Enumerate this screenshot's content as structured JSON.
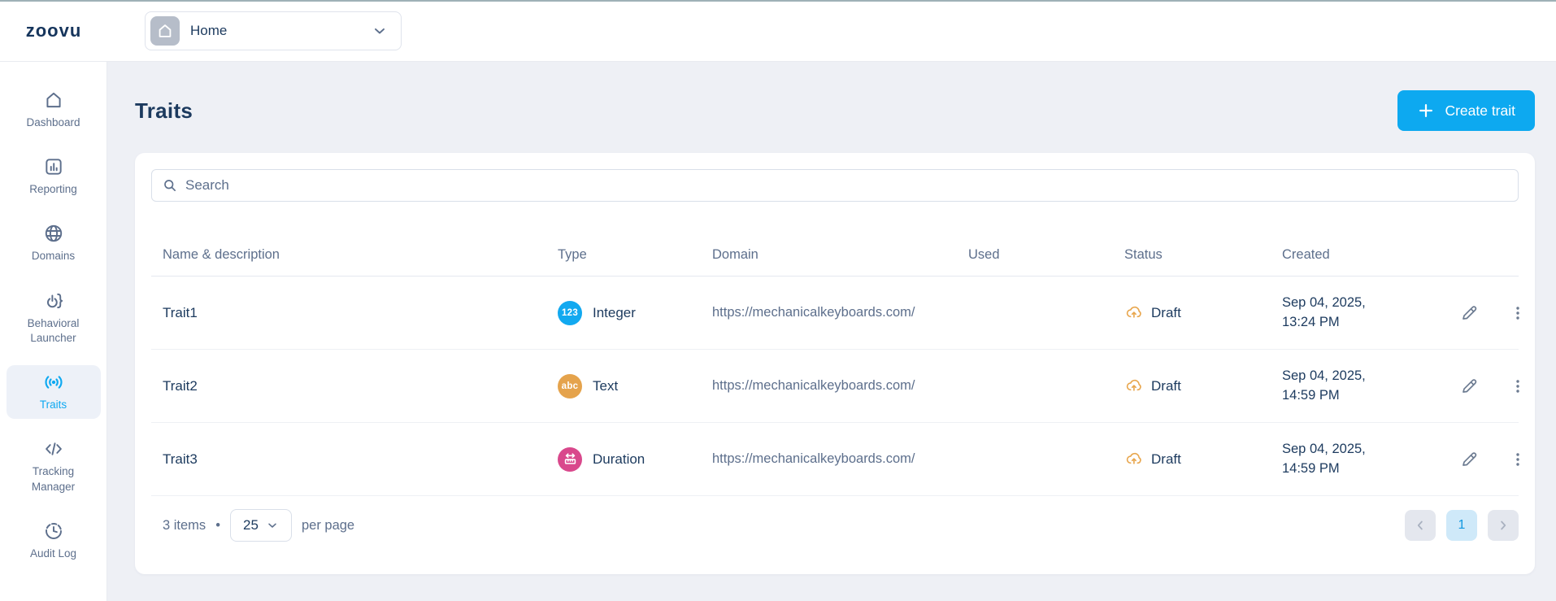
{
  "topbar": {
    "logo_text": "zoovu",
    "workspace_selector": {
      "label": "Home",
      "icon": "home-icon",
      "chevron": "chevron-down-icon"
    }
  },
  "sidebar": {
    "items": [
      {
        "label": "Dashboard",
        "icon": "home-icon",
        "active": false
      },
      {
        "label": "Reporting",
        "icon": "bar-chart-icon",
        "active": false
      },
      {
        "label": "Domains",
        "icon": "globe-icon",
        "active": false
      },
      {
        "label": "Behavioral Launcher",
        "icon": "power-brace-icon",
        "active": false
      },
      {
        "label": "Traits",
        "icon": "broadcast-icon",
        "active": true
      },
      {
        "label": "Tracking Manager",
        "icon": "code-icon",
        "active": false
      },
      {
        "label": "Audit Log",
        "icon": "clock-icon",
        "active": false
      }
    ]
  },
  "page": {
    "title": "Traits",
    "create_button_label": "Create trait"
  },
  "search": {
    "placeholder": "Search",
    "value": ""
  },
  "table": {
    "columns": {
      "name": "Name & description",
      "type": "Type",
      "domain": "Domain",
      "used": "Used",
      "status": "Status",
      "created": "Created"
    },
    "rows": [
      {
        "name": "Trait1",
        "type": "Integer",
        "type_badge": "123",
        "type_icon": "number-123-icon",
        "domain": "https://mechanicalkeyboards.com/",
        "used": "",
        "status": "Draft",
        "status_icon": "cloud-upload-icon",
        "created_line1": "Sep 04, 2025,",
        "created_line2": "13:24 PM"
      },
      {
        "name": "Trait2",
        "type": "Text",
        "type_badge": "abc",
        "type_icon": "text-abc-icon",
        "domain": "https://mechanicalkeyboards.com/",
        "used": "",
        "status": "Draft",
        "status_icon": "cloud-upload-icon",
        "created_line1": "Sep 04, 2025,",
        "created_line2": "14:59 PM"
      },
      {
        "name": "Trait3",
        "type": "Duration",
        "type_badge": "ruler-icon",
        "type_icon": "ruler-icon",
        "domain": "https://mechanicalkeyboards.com/",
        "used": "",
        "status": "Draft",
        "status_icon": "cloud-upload-icon",
        "created_line1": "Sep 04, 2025,",
        "created_line2": "14:59 PM"
      }
    ]
  },
  "footer": {
    "items_count": "3 items",
    "separator": "•",
    "page_size": "25",
    "per_page_label": "per page",
    "pagination": {
      "current_page": "1"
    }
  },
  "colors": {
    "accent_blue": "#0da9f0",
    "navy_text": "#1c3a5e",
    "muted_text": "#5d6f8c",
    "type_integer_bg": "#12a9f0",
    "type_text_bg": "#e5a34c",
    "type_duration_bg": "#d9488c",
    "status_draft_icon": "#e8a64d",
    "active_sidebar_bg": "#edf1f8",
    "current_page_bg": "#cfe9f9",
    "page_background": "#eef0f5"
  }
}
